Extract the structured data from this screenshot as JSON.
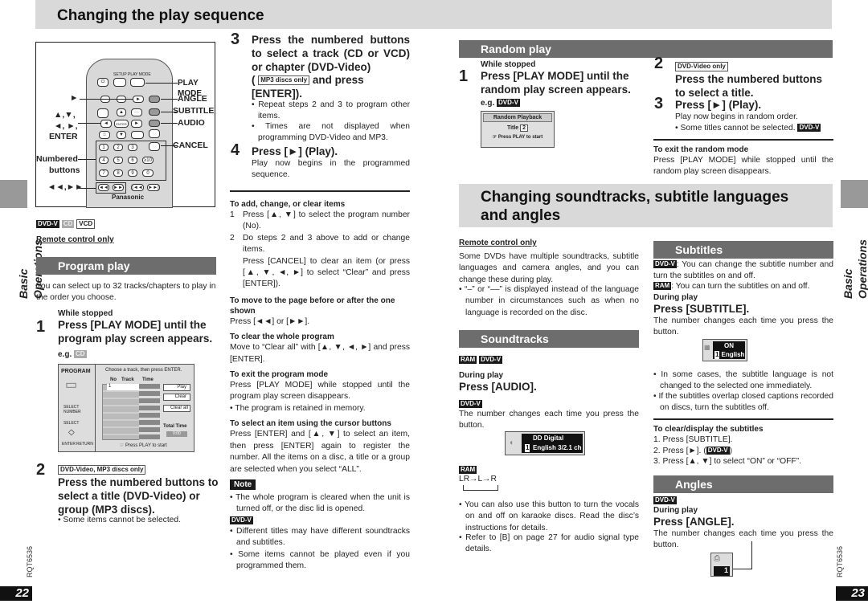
{
  "left_page": {
    "title": "Changing the play sequence",
    "side_label": "Basic Operations",
    "doc_code": "RQT6536",
    "page_number": "22",
    "remote": {
      "labels": {
        "play_mode": "PLAY MODE",
        "angle": "ANGLE",
        "subtitle": "SUBTITLE",
        "audio": "AUDIO",
        "cancel": "CANCEL",
        "play": "►",
        "cursor_line1": "▲,▼,",
        "cursor_line2": "◄, ►,",
        "enter": "ENTER",
        "numbered_line1": "Numbered",
        "numbered_line2": "buttons",
        "skip": "◄◄,►►"
      },
      "small": {
        "setup": "SETUP",
        "playmode": "PLAY MODE",
        "angle": "ANGLE",
        "subtitle": "SUBTITLE",
        "audio": "AUDIO",
        "cancel": "CANCEL",
        "enter": "ENTER",
        "brand": "Panasonic",
        "num": [
          "1",
          "2",
          "3",
          "",
          "4",
          "5",
          "6",
          "≥10",
          "7",
          "8",
          "9",
          "0"
        ],
        "transport": [
          "◄◄",
          "►►",
          "|◄◄",
          "►►|"
        ]
      }
    },
    "disc_tags": [
      "DVD-V",
      "CD",
      "VCD"
    ],
    "remote_only": "Remote control only",
    "program_play": {
      "heading": "Program play",
      "intro": "You can select up to 32 tracks/chapters to play in the order you choose.",
      "step1": {
        "num": "1",
        "pre": "While stopped",
        "text": "Press [PLAY MODE] until the program play screen appears.",
        "eg": "e.g.",
        "eg_tag": "CD"
      },
      "screen": {
        "title": "PROGRAM",
        "instruction": "Choose a track, then press ENTER.",
        "col_no": "No",
        "col_track": "Track",
        "col_time": "Time",
        "first_row_no": "1",
        "btn_play": "Play",
        "btn_clear": "Clear",
        "btn_clear_all": "Clear all",
        "total_time_label": "Total Time",
        "total_time": "0:00",
        "select_number": "SELECT NUMBER",
        "select": "SELECT",
        "enter": "ENTER",
        "return": "RETURN",
        "footer": "☞ Press PLAY to start"
      },
      "step2": {
        "num": "2",
        "tag": "DVD-Video, MP3 discs only",
        "text": "Press the numbered buttons to select a title (DVD-Video) or group (MP3 discs).",
        "bullet": "Some items cannot be selected."
      },
      "step3": {
        "num": "3",
        "text": "Press the numbered buttons to select a track (CD or VCD) or chapter (DVD-Video)",
        "tag": "MP3 discs only",
        "text2": "and press [ENTER]).",
        "bullets": [
          "Repeat steps 2 and 3 to program other items.",
          "Times are not displayed when programming DVD-Video and MP3."
        ]
      },
      "step4": {
        "num": "4",
        "text": "Press [►] (Play).",
        "body": "Play now begins in the programmed sequence."
      }
    },
    "notes": {
      "add_change_clear": {
        "heading": "To add, change, or clear items",
        "items": [
          {
            "n": "1",
            "text": "Press [▲, ▼] to select the program number (No)."
          },
          {
            "n": "2",
            "text": "Do steps 2 and 3 above to add or change items.",
            "extra": "Press [CANCEL] to clear an item (or press [▲, ▼, ◄, ►] to select “Clear” and press [ENTER])."
          }
        ]
      },
      "move_page": {
        "heading": "To move to the page before or after the one shown",
        "body": "Press [◄◄] or [►►]."
      },
      "clear_whole": {
        "heading": "To clear the whole program",
        "body": "Move to “Clear all” with [▲, ▼, ◄, ►] and press [ENTER]."
      },
      "exit_program": {
        "heading": "To exit the program mode",
        "body": "Press [PLAY MODE] while stopped until the program play screen disappears.",
        "bullet": "The program is retained in memory."
      },
      "cursor_select": {
        "heading": "To select an item using the cursor buttons",
        "body": "Press [ENTER] and [▲, ▼] to select an item, then press [ENTER] again to register the number. All the items on a disc, a title or a group are selected when you select “ALL”."
      },
      "note_label": "Note",
      "note_bullet": "The whole program is cleared when the unit is turned off, or the disc lid is opened.",
      "dvd_tag": "DVD-V",
      "dvd_bullets": [
        "Different titles may have different soundtracks and subtitles.",
        "Some items cannot be played even if you programmed them."
      ]
    }
  },
  "right_page": {
    "side_label": "Basic Operations",
    "doc_code": "RQT6536",
    "page_number": "23",
    "random_play": {
      "heading": "Random play",
      "step1": {
        "num": "1",
        "pre": "While stopped",
        "text": "Press [PLAY MODE] until the random play screen appears.",
        "eg": "e.g.",
        "eg_tag": "DVD-V"
      },
      "screen": {
        "title": "Random Playback",
        "title_label": "Title",
        "title_value": "2",
        "footer": "☞ Press PLAY to start"
      },
      "step2": {
        "num": "2",
        "tag": "DVD-Video only",
        "text": "Press the numbered buttons to select a title."
      },
      "step3": {
        "num": "3",
        "text": "Press [►] (Play).",
        "body": "Play now begins in random order.",
        "bullet": "Some titles cannot be selected.",
        "bullet_tag": "DVD-V"
      },
      "exit": {
        "heading": "To exit the random mode",
        "body": "Press [PLAY MODE] while stopped until the random play screen disappears."
      }
    },
    "main_title": "Changing soundtracks, subtitle languages and angles",
    "remote_only": "Remote control only",
    "intro": "Some DVDs have multiple soundtracks, subtitle languages and camera angles, and you can change these during play.",
    "intro_bullet": "“–” or “––” is displayed instead of the language number in circumstances such as when no language is recorded on the disc.",
    "soundtracks": {
      "heading": "Soundtracks",
      "tags": [
        "RAM",
        "DVD-V"
      ],
      "pre": "During play",
      "action": "Press [AUDIO].",
      "dvd_tag": "DVD-V",
      "body": "The number changes each time you press the button.",
      "osd": {
        "line1": "DD Digital",
        "num": "1",
        "line2": "English  3/2.1 ch"
      },
      "ram_tag": "RAM",
      "ram_cycle": "LR→L→R",
      "bullets": [
        "You can also use this button to turn the vocals on and off on karaoke discs. Read the disc’s instructions for details.",
        "Refer to [B] on page 27 for audio signal type details."
      ]
    },
    "subtitles": {
      "heading": "Subtitles",
      "dvd_tag": "DVD-V",
      "dvd_text": ": You can change the subtitle number and turn the subtitles on and off.",
      "ram_tag": "RAM",
      "ram_text": ":    You can turn the subtitles on and off.",
      "pre": "During play",
      "action": "Press [SUBTITLE].",
      "body": "The number changes each time you press the button.",
      "osd": {
        "line1": "ON",
        "num": "1",
        "line2": "English"
      },
      "bullets": [
        "In some cases, the subtitle language is not changed to the selected one immediately.",
        "If the subtitles overlap closed captions recorded on discs, turn the subtitles off."
      ],
      "clear_display": {
        "heading": "To clear/display the subtitles",
        "items": [
          "1. Press [SUBTITLE].",
          "2. Press [►]. (",
          "3. Press [▲, ▼] to select “ON” or “OFF”."
        ],
        "item2_tag": "DVD-V",
        "item2_end": ")"
      }
    },
    "angles": {
      "heading": "Angles",
      "tag": "DVD-V",
      "pre": "During play",
      "action": "Press [ANGLE].",
      "body": "The number changes each time you press the button.",
      "osd_num": "1"
    }
  }
}
